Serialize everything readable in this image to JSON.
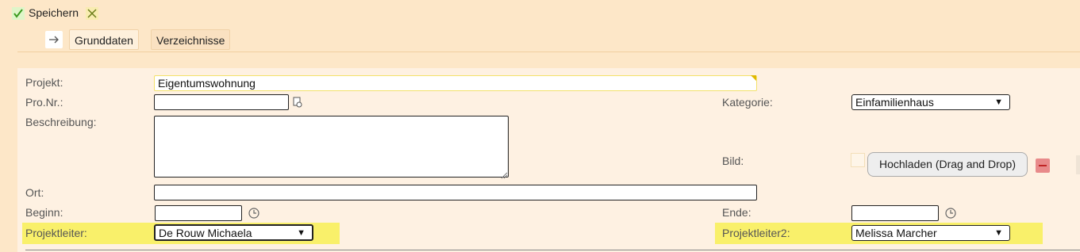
{
  "toolbar": {
    "save_label": "Speichern"
  },
  "tabs": [
    {
      "label": "Grunddaten"
    },
    {
      "label": "Verzeichnisse"
    }
  ],
  "form": {
    "projekt_label": "Projekt:",
    "projekt_value": "Eigentumswohnung",
    "pronr_label": "Pro.Nr.:",
    "pronr_value": "",
    "kategorie_label": "Kategorie:",
    "kategorie_value": "Einfamilienhaus",
    "beschreibung_label": "Beschreibung:",
    "beschreibung_value": "",
    "bild_label": "Bild:",
    "upload_label": "Hochladen (Drag and Drop)",
    "ort_label": "Ort:",
    "ort_value": "",
    "beginn_label": "Beginn:",
    "beginn_value": "",
    "ende_label": "Ende:",
    "ende_value": "",
    "projektleiter_label": "Projektleiter:",
    "projektleiter_value": "De Rouw Michaela",
    "projektleiter2_label": "Projektleiter2:",
    "projektleiter2_value": "Melissa Marcher"
  },
  "colors": {
    "background": "#fde7c8",
    "panel": "#fef1e2",
    "highlight": "#f9f06a",
    "remove_button": "#e88a8a"
  }
}
